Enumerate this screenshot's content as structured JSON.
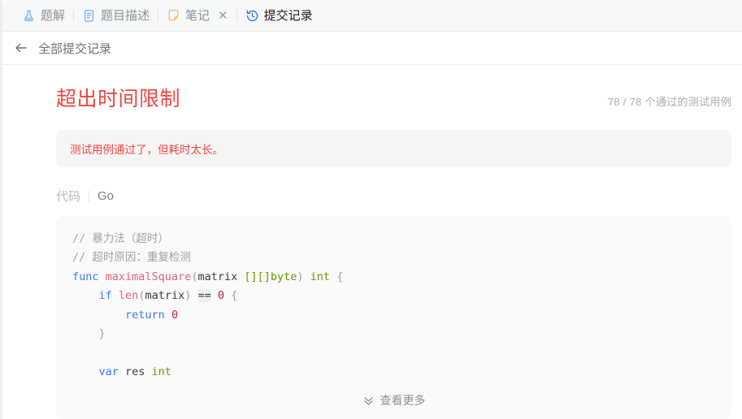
{
  "tabs": [
    {
      "id": "solution",
      "label": "题解",
      "icon": "flask-icon",
      "active": false,
      "closable": false
    },
    {
      "id": "description",
      "label": "题目描述",
      "icon": "document-icon",
      "active": false,
      "closable": false
    },
    {
      "id": "notes",
      "label": "笔记",
      "icon": "note-icon",
      "active": false,
      "closable": true,
      "close_label": "✕"
    },
    {
      "id": "submissions",
      "label": "提交记录",
      "icon": "history-icon",
      "active": true,
      "closable": false
    }
  ],
  "back_bar": {
    "icon": "back-arrow-icon",
    "label": "全部提交记录"
  },
  "result": {
    "verdict": "超出时间限制",
    "verdict_color": "#ef4743",
    "testcases_text": "78 / 78  个通过的测试用例",
    "passed": 78,
    "total": 78,
    "notice": "测试用例通过了，但耗时太长。"
  },
  "code_section": {
    "label": "代码",
    "language": "Go",
    "view_more": "查看更多",
    "view_more_icon": "double-chevron-down-icon",
    "lines": [
      [
        {
          "t": "// 暴力法（超时）",
          "c": "tok-cm"
        }
      ],
      [
        {
          "t": "// 超时原因：重复检测",
          "c": "tok-cm"
        }
      ],
      [
        {
          "t": "func ",
          "c": "tok-kw"
        },
        {
          "t": "maximalSquare",
          "c": "tok-fn"
        },
        {
          "t": "(",
          "c": "tok-pn"
        },
        {
          "t": "matrix ",
          "c": "tok-pl"
        },
        {
          "t": "[][]byte",
          "c": "tok-ty"
        },
        {
          "t": ")",
          "c": "tok-pn"
        },
        {
          "t": " ",
          "c": "tok-pl"
        },
        {
          "t": "int",
          "c": "tok-ty"
        },
        {
          "t": " ",
          "c": "tok-pl"
        },
        {
          "t": "{",
          "c": "tok-pn"
        }
      ],
      [
        {
          "t": "    ",
          "c": "tok-pl"
        },
        {
          "t": "if ",
          "c": "tok-kw"
        },
        {
          "t": "len",
          "c": "tok-bi"
        },
        {
          "t": "(",
          "c": "tok-pn"
        },
        {
          "t": "matrix",
          "c": "tok-pl"
        },
        {
          "t": ")",
          "c": "tok-pn"
        },
        {
          "t": " ",
          "c": "tok-pl"
        },
        {
          "t": "==",
          "c": "tok-op"
        },
        {
          "t": " ",
          "c": "tok-pl"
        },
        {
          "t": "0",
          "c": "tok-num"
        },
        {
          "t": " ",
          "c": "tok-pl"
        },
        {
          "t": "{",
          "c": "tok-pn"
        }
      ],
      [
        {
          "t": "        ",
          "c": "tok-pl"
        },
        {
          "t": "return ",
          "c": "tok-kw"
        },
        {
          "t": "0",
          "c": "tok-num"
        }
      ],
      [
        {
          "t": "    ",
          "c": "tok-pl"
        },
        {
          "t": "}",
          "c": "tok-pn"
        }
      ],
      [
        {
          "t": "",
          "c": "tok-pl"
        }
      ],
      [
        {
          "t": "    ",
          "c": "tok-pl"
        },
        {
          "t": "var ",
          "c": "tok-kw"
        },
        {
          "t": "res ",
          "c": "tok-pl"
        },
        {
          "t": "int",
          "c": "tok-ty"
        }
      ]
    ]
  }
}
